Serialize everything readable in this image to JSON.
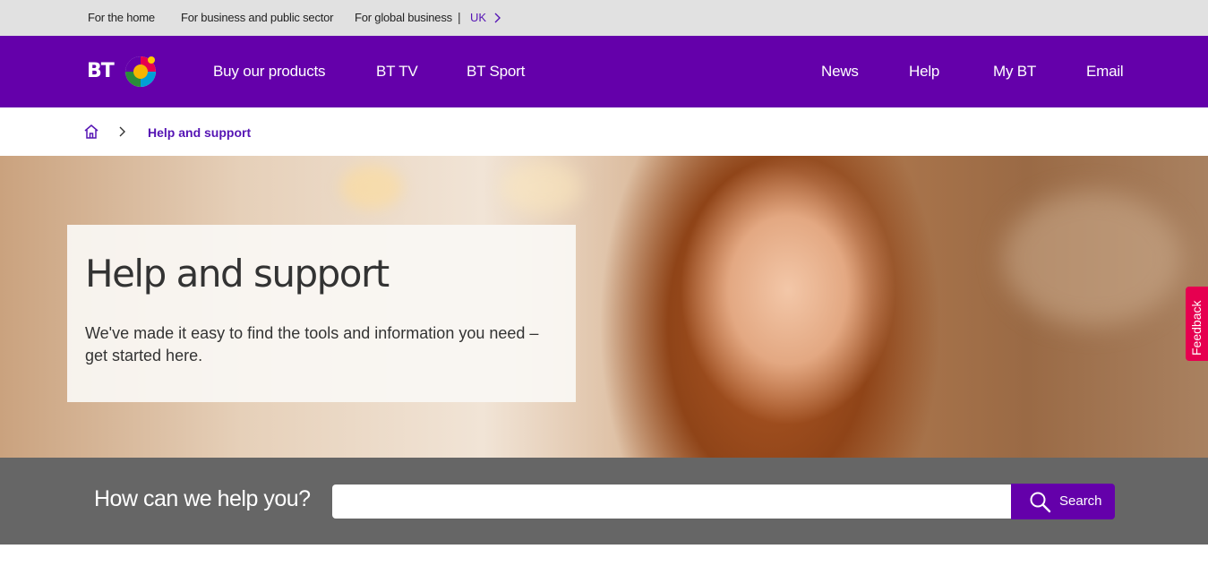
{
  "topbar": {
    "links": [
      "For the home",
      "For business and public sector",
      "For global business"
    ],
    "region": "UK"
  },
  "nav": {
    "logo_text": "BT",
    "primary": [
      "Buy our products",
      "BT TV",
      "BT Sport"
    ],
    "secondary": [
      "News",
      "Help",
      "My BT",
      "Email"
    ]
  },
  "breadcrumb": {
    "current": "Help and support"
  },
  "hero": {
    "title": "Help and support",
    "description": "We've made it easy to find the tools and information you need – get started here."
  },
  "feedback": {
    "label": "Feedback"
  },
  "search": {
    "prompt": "How can we help you?",
    "placeholder": "",
    "button_label": "Search"
  },
  "colors": {
    "brand_purple": "#6400aa",
    "link_purple": "#5514b4",
    "feedback_pink": "#e60050",
    "search_band": "#666666",
    "topbar": "#e1e1e1"
  },
  "icons": [
    "chevron-right-icon",
    "home-icon",
    "search-icon",
    "bt-globe-icon"
  ]
}
